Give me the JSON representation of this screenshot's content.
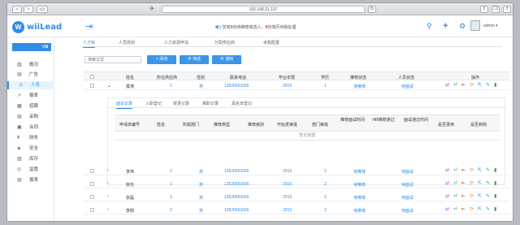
{
  "browser": {
    "url": "192.168.31.137",
    "back_icon": "left-arrow-icon",
    "forward_icon": "right-arrow-icon"
  },
  "header": {
    "brand": "wiiLead",
    "notice_prefix": "您有",
    "notice_count1": "5",
    "notice_mid": "份待推荐候选人，",
    "notice_count2": "8",
    "notice_suffix": "份简历待我处理",
    "user": "admin"
  },
  "sidebar": {
    "group": "VM",
    "items": [
      {
        "label": "概况",
        "icon": "▥"
      },
      {
        "label": "广告",
        "icon": "▤"
      },
      {
        "label": "人员",
        "icon": "♙"
      },
      {
        "label": "报表",
        "icon": "↗"
      },
      {
        "label": "招聘",
        "icon": "▦"
      },
      {
        "label": "采购",
        "icon": "▤"
      },
      {
        "label": "合同",
        "icon": "▣"
      },
      {
        "label": "财务",
        "icon": "¥"
      },
      {
        "label": "安全",
        "icon": "◈"
      },
      {
        "label": "库存",
        "icon": "▧"
      },
      {
        "label": "监管",
        "icon": "◎"
      },
      {
        "label": "报表",
        "icon": "▤"
      }
    ]
  },
  "tabs": [
    "人才库",
    "人员规划",
    "人力资源申请",
    "分配供应商",
    "考勤配置"
  ],
  "toolbar": {
    "search_placeholder": "搜索过滤",
    "btn_add": "+ 添加",
    "btn_filter": "⊕ 筛选",
    "btn_notify": "⊕ 通知"
  },
  "table": {
    "headers": [
      "姓名",
      "所在供应商",
      "性别",
      "联系电话",
      "毕业年限",
      "学历",
      "推荐状态",
      "人员状态",
      "操作"
    ],
    "rows": [
      {
        "name": "斌涛",
        "supplier": "2",
        "gender": "男",
        "phone": "13520661665",
        "year": "2015",
        "edu": "1",
        "rec": "待推荐",
        "status": "待面试"
      },
      {
        "name": "李伟",
        "supplier": "2",
        "gender": "男",
        "phone": "13520661665",
        "year": "2016",
        "edu": "2",
        "rec": "待推荐",
        "status": "待面试"
      },
      {
        "name": "晓光",
        "supplier": "1",
        "gender": "男",
        "phone": "13520661665",
        "year": "2016",
        "edu": "2",
        "rec": "待推荐",
        "status": "待面试"
      },
      {
        "name": "张磊",
        "supplier": "3",
        "gender": "男",
        "phone": "13520661665",
        "year": "2015",
        "edu": "2",
        "rec": "待推荐",
        "status": "待面试"
      },
      {
        "name": "李刚",
        "supplier": "2",
        "gender": "男",
        "phone": "13520661665",
        "year": "2015",
        "edu": "2",
        "rec": "待推荐",
        "status": "待面试"
      }
    ]
  },
  "subpanel": {
    "tabs": [
      "面试记录",
      "入职登记",
      "变更记录",
      "离职记录",
      "黑名单登记"
    ],
    "headers": [
      "申请单编号",
      "姓名",
      "所属部门",
      "推荐类型",
      "推荐级别",
      "开始发审批",
      "部门审批",
      "推荐面试时间",
      "HR推荐通过",
      "面试通过时间",
      "是否录用",
      "是否到岗"
    ],
    "empty": "暂无数据"
  },
  "colors": {
    "accent": "#2f8ee5",
    "red": "#e23b3b"
  }
}
